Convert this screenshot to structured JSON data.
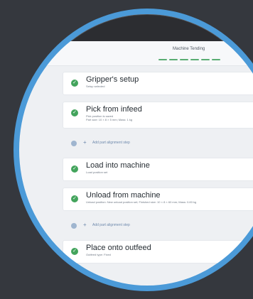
{
  "header": {
    "title": "Machine Tending"
  },
  "steps": [
    {
      "title": "Gripper's setup",
      "subtitle": "Setup selected"
    },
    {
      "title": "Pick from infeed",
      "subtitle": "Pick position is saved",
      "subtitle2": "Part size: 10 × 8 × 5 mm; Mass: 1 kg"
    },
    {
      "title": "Load into machine",
      "subtitle": "Load position set"
    },
    {
      "title": "Unload from machine",
      "subtitle": "Unload position: New unload position set; Finished size: 10 × 8 × 60 mm; Mass: 0.83 kg"
    },
    {
      "title": "Place onto outfeed",
      "subtitle": "Outfeed type: Fixed"
    }
  ],
  "actions": {
    "add_alignment_1": "Add part alignment step",
    "add_alignment_2": "Add part alignment step"
  },
  "colors": {
    "accent_blue": "#4b9ad8",
    "success_green": "#43a45c",
    "background_dark": "#35383e"
  }
}
